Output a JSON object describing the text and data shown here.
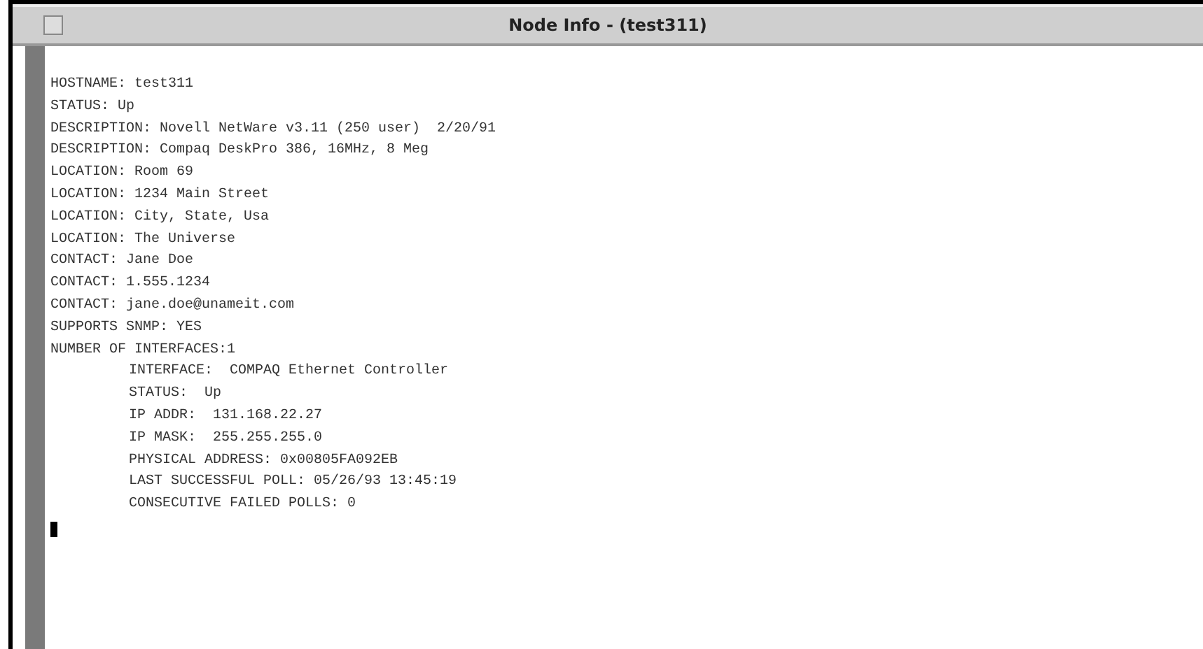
{
  "window": {
    "title": "Node Info - (test311)"
  },
  "lines": [
    {
      "text": "HOSTNAME: test311"
    },
    {
      "text": "STATUS: Up"
    },
    {
      "text": "DESCRIPTION: Novell NetWare v3.11 (250 user)  2/20/91"
    },
    {
      "text": "DESCRIPTION: Compaq DeskPro 386, 16MHz, 8 Meg"
    },
    {
      "text": "LOCATION: Room 69"
    },
    {
      "text": "LOCATION: 1234 Main Street"
    },
    {
      "text": "LOCATION: City, State, Usa"
    },
    {
      "text": "LOCATION: The Universe"
    },
    {
      "text": "CONTACT: Jane Doe"
    },
    {
      "text": "CONTACT: 1.555.1234"
    },
    {
      "text": "CONTACT: jane.doe@unameit.com"
    },
    {
      "text": "SUPPORTS SNMP: YES"
    },
    {
      "text": "NUMBER OF INTERFACES:1",
      "children": [
        {
          "text": "INTERFACE:  COMPAQ Ethernet Controller"
        },
        {
          "text": "STATUS:  Up"
        },
        {
          "text": "IP ADDR:  131.168.22.27"
        },
        {
          "text": "IP MASK:  255.255.255.0"
        },
        {
          "text": "PHYSICAL ADDRESS: 0x00805FA092EB"
        },
        {
          "text": "LAST SUCCESSFUL POLL: 05/26/93 13:45:19"
        },
        {
          "text": "CONSECUTIVE FAILED POLLS: 0"
        }
      ]
    }
  ]
}
